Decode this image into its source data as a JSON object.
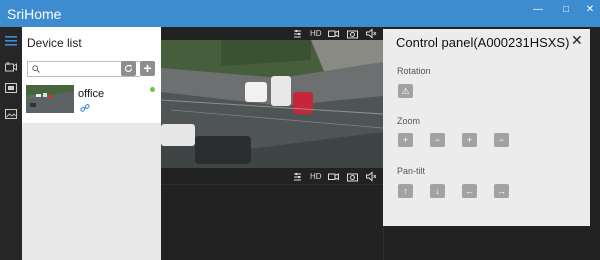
{
  "app": {
    "title": "SriHome"
  },
  "window_controls": {
    "minimize": "—",
    "maximize": "□",
    "close": "✕"
  },
  "device_list": {
    "title": "Device list",
    "search_placeholder": "",
    "add_label": "+",
    "devices": [
      {
        "name": "office",
        "status": "online",
        "status_color": "#6cc24a"
      }
    ]
  },
  "toolbar": {
    "hd_label": "HD"
  },
  "control_panel": {
    "title": "Control panel(A000231HSXS)",
    "close_label": "✕",
    "sections": {
      "rotation": {
        "label": "Rotation",
        "buttons": [
          "⚠"
        ]
      },
      "zoom": {
        "label": "Zoom",
        "buttons": [
          "+",
          "−",
          "+",
          "−"
        ]
      },
      "pan_tilt": {
        "label": "Pan-tilt",
        "buttons": [
          "↑",
          "↓",
          "←",
          "→"
        ]
      }
    }
  },
  "colors": {
    "titlebar": "#3d8cd0",
    "panel_bg": "#ececec",
    "button_gray": "#a2a2a2"
  }
}
